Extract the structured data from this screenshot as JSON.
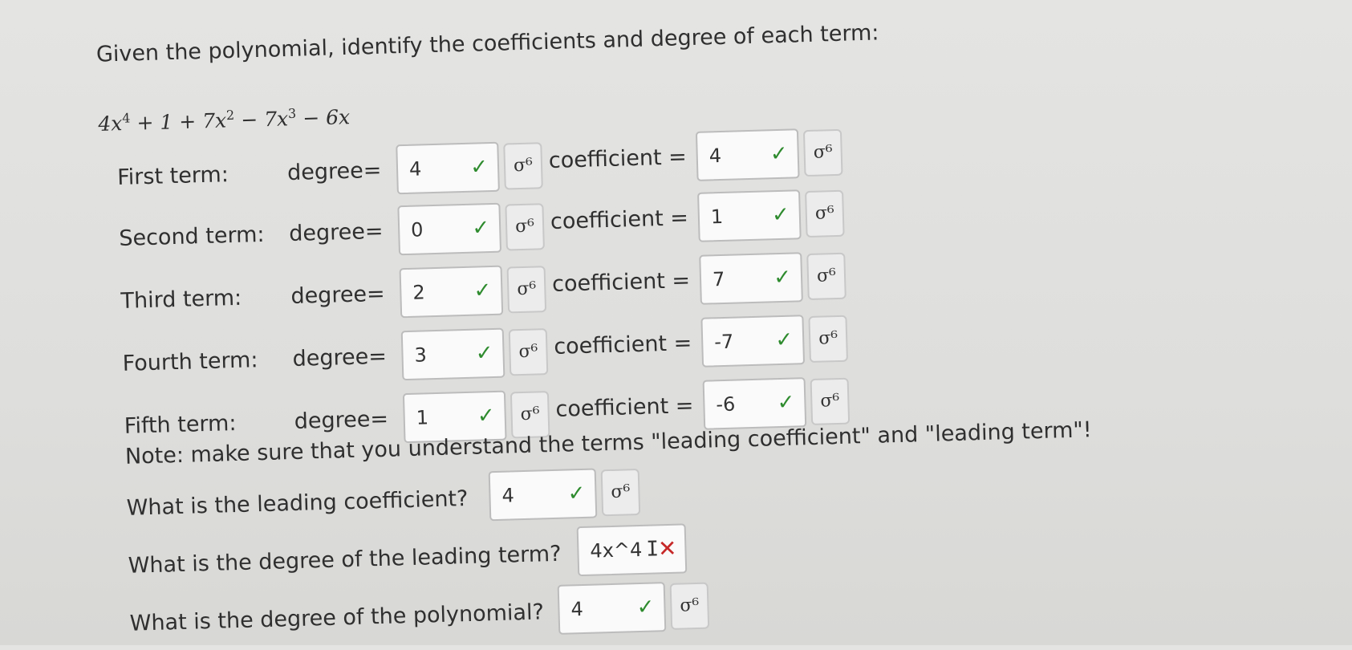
{
  "prompt": "Given the polynomial, identify the coefficients and degree of each term:",
  "polynomial": {
    "t1": "4x",
    "e1": "4",
    "t2": " + 1 + 7x",
    "e2": "2",
    "t3": " − 7x",
    "e3": "3",
    "t4": " − 6x"
  },
  "degree_label": "degree=",
  "coefficient_label": "coefficient =",
  "terms": [
    {
      "label": "First term:",
      "degree": "4",
      "coefficient": "4"
    },
    {
      "label": "Second term:",
      "degree": "0",
      "coefficient": "1"
    },
    {
      "label": "Third term:",
      "degree": "2",
      "coefficient": "7"
    },
    {
      "label": "Fourth term:",
      "degree": "3",
      "coefficient": "-7"
    },
    {
      "label": "Fifth term:",
      "degree": "1",
      "coefficient": "-6"
    }
  ],
  "note": "Note: make sure that you understand the terms \"leading coefficient\" and \"leading term\"!",
  "questions": [
    {
      "text": "What is the leading coefficient?",
      "answer": "4",
      "status": "correct"
    },
    {
      "text": "What is the degree of the leading term?",
      "answer": "4x^4",
      "status": "incorrect"
    },
    {
      "text": "What is the degree of the polynomial?",
      "answer": "4",
      "status": "correct"
    }
  ],
  "icons": {
    "check": "✓",
    "cross": "✕",
    "tool": "σ⁶"
  }
}
